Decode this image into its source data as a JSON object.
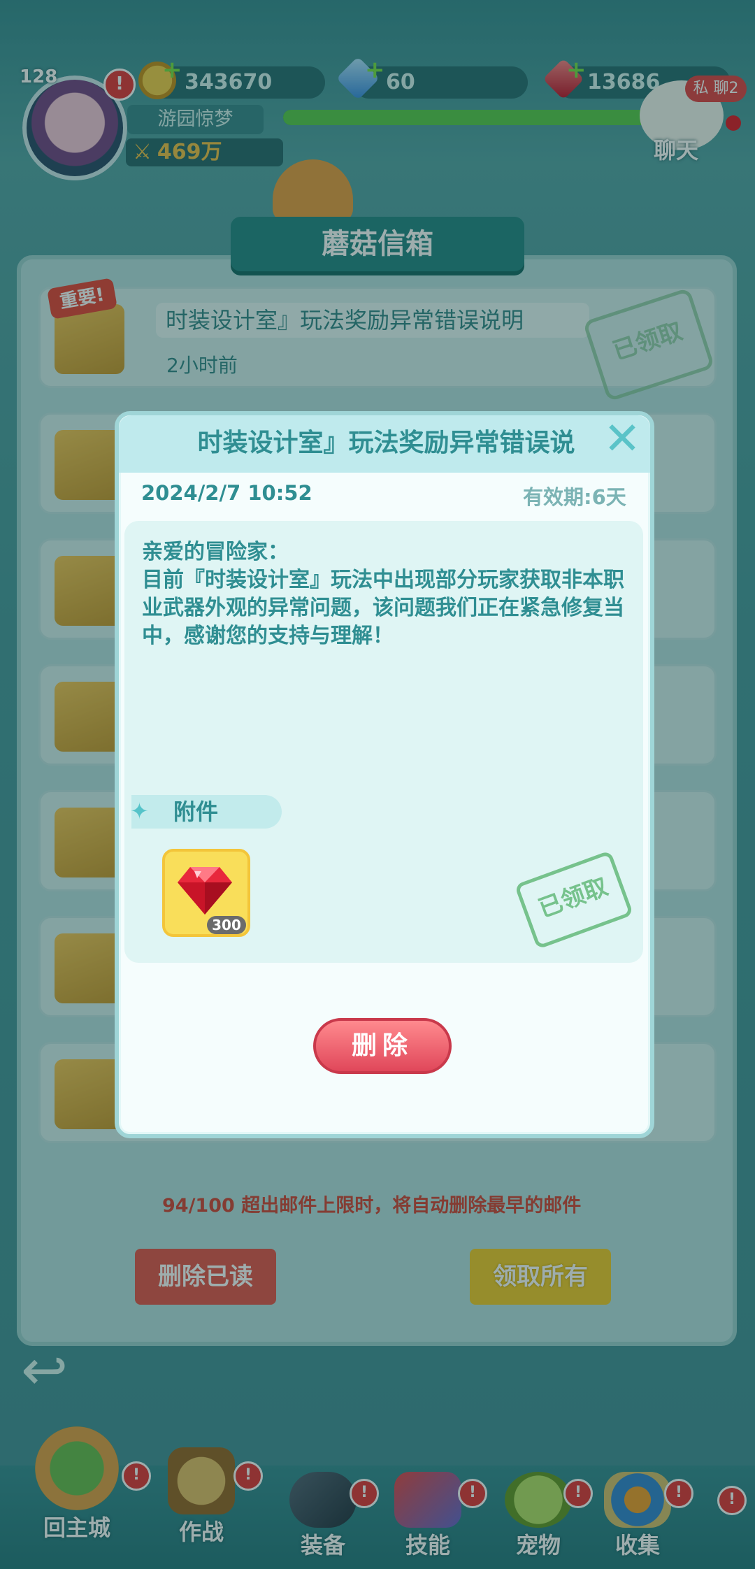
{
  "hud": {
    "level": "128",
    "player_name": "游园惊梦",
    "power": "469万",
    "gold": "343670",
    "diamond": "60",
    "ruby": "13686",
    "exp_progress": 0.97,
    "chat_label": "聊天",
    "private_chat_badge": "私 聊2",
    "alert_mark": "!"
  },
  "mailbox": {
    "title": "蘑菇信箱",
    "important_tag": "重要!",
    "claimed_stamp": "已领取",
    "first_mail": {
      "title": "时装设计室』玩法奖励异常错误说明",
      "time": "2小时前"
    },
    "count_notice": "94/100  超出邮件上限时，将自动删除最早的邮件",
    "delete_read_label": "删除已读",
    "claim_all_label": "领取所有"
  },
  "dialog": {
    "title": "时装设计室』玩法奖励异常错误说",
    "date": "2024/2/7 10:52",
    "expiry": "有效期:6天",
    "greeting": "亲爱的冒险家：",
    "body": "目前『时装设计室』玩法中出现部分玩家获取非本职业武器外观的异常问题，该问题我们正在紧急修复当中，感谢您的支持与理解！",
    "attachment_label": "附件",
    "attachment_item": {
      "icon": "ruby-icon",
      "count": "300"
    },
    "claimed_stamp": "已领取",
    "delete_label": "删除"
  },
  "nav": {
    "items": [
      {
        "label": "回主城",
        "icon": "town-icon"
      },
      {
        "label": "作战",
        "icon": "battle-icon"
      },
      {
        "label": "装备",
        "icon": "equipment-icon"
      },
      {
        "label": "技能",
        "icon": "skill-icon"
      },
      {
        "label": "宠物",
        "icon": "pet-icon"
      },
      {
        "label": "收集",
        "icon": "collection-icon"
      }
    ]
  },
  "colors": {
    "accent_teal": "#2f8e92",
    "alert_red": "#e63a3a",
    "stamp_green": "#76c28c"
  }
}
